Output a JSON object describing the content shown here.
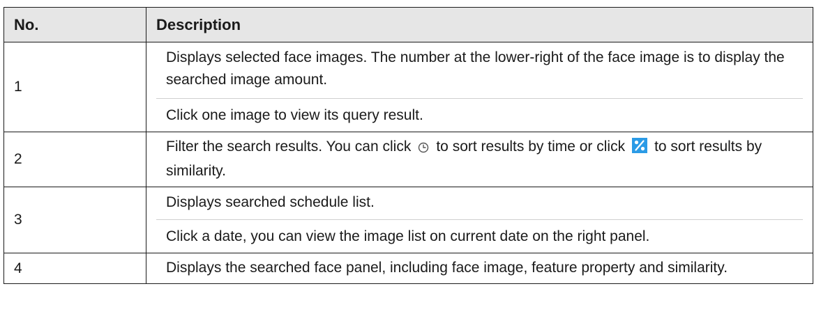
{
  "table": {
    "headers": {
      "no": "No.",
      "description": "Description"
    },
    "rows": [
      {
        "no": "1",
        "paragraphs": [
          "Displays selected face images. The number at the lower-right of the face image is to display the searched image amount.",
          "Click one image to view its query result."
        ]
      },
      {
        "no": "2",
        "text_before_clock": "Filter the search results. You can click",
        "text_between_icons": "to sort results by time or click",
        "text_after_similarity": "to sort results by similarity."
      },
      {
        "no": "3",
        "paragraphs": [
          "Displays searched schedule list.",
          "Click a date, you can view the image list on current date on the right panel."
        ]
      },
      {
        "no": "4",
        "paragraphs": [
          "Displays the searched face panel, including face image, feature property and similarity."
        ]
      }
    ]
  },
  "icons": {
    "clock": "clock-icon",
    "similarity": "similarity-sort-icon",
    "similarity_color": "#2b9be6"
  }
}
